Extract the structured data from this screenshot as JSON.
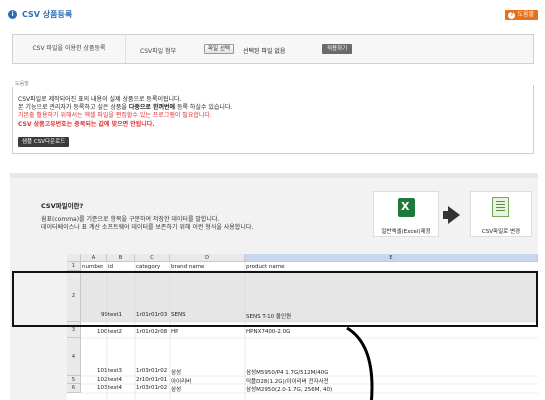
{
  "header": {
    "title": "CSV 상품등록",
    "help_label": "도움말"
  },
  "upload": {
    "tab_label": "CSV 파일을 이용한 상품등록",
    "attach_label": "CSV파일 첨부",
    "file_button": "파일 선택",
    "file_status": "선택된 파일 없음",
    "apply_button": "적용하기"
  },
  "help": {
    "legend": "도움말",
    "line1": "CSV파일로 제작되어진 표의 내용이 실제 상품으로 등록이됩니다.",
    "line2_a": "본 기능으로 관리자가 등록하고 싶은 상품을 ",
    "line2_b": "다중으로 한꺼번에",
    "line2_c": " 등록 하실수 있습니다.",
    "line3": "기본출 활용하기 위해서는 엑셀 파일을 편집할수 있는 프로그램이 필요합니다.",
    "line4": "CSV 상품고유번호는 중복되는 값에 맞으면 안됩니다.",
    "sample_button": "샘플 CSV다운로드"
  },
  "guide": {
    "question": "CSV파일이란?",
    "desc1": "쉼표(comma)를 기준으로 항목을 구분하여 저장한 데이터를 말합니다.",
    "desc2": "데이터베이스나 표 계산 소프트웨어 데이터를 보존하기 위해 이런 형식을 사용합니다.",
    "excel_label": "일반엑셀(Excel)제정",
    "csv_label": "CSV파일로 변경"
  },
  "sheet": {
    "columns": [
      "A",
      "B",
      "C",
      "D",
      "E"
    ],
    "rows": [
      {
        "num": "1",
        "a": "number",
        "b": "id",
        "c": "category",
        "d": "brand name",
        "e": "product name"
      },
      {
        "num": "2",
        "a": "99",
        "b": "test1",
        "c": "1r01r01r03",
        "d": "SENS",
        "e": "SENS T-10 올인원"
      },
      {
        "num": "3",
        "a": "100",
        "b": "test2",
        "c": "1r01r02r08",
        "d": "HP",
        "e": "HPNX7400-2.0G"
      },
      {
        "num": "4",
        "a": "101",
        "b": "test3",
        "c": "1r03r01r02",
        "d": "삼성",
        "e": "삼성M5950/P4 1.7G/512M/40G"
      },
      {
        "num": "5",
        "a": "102",
        "b": "test4",
        "c": "2r10r01r01",
        "d": "아이리버",
        "e": "덕플D28(1.2G)/아이리버 전자사전"
      },
      {
        "num": "6",
        "a": "103",
        "b": "test4",
        "c": "1r03r01r02",
        "d": "삼성",
        "e": "삼성M2950(2.0-1.7G, 256M, 40)"
      }
    ]
  },
  "colors": {
    "title_blue": "#2e6db4",
    "help_orange": "#e8701a",
    "warn_red": "#d33333"
  }
}
